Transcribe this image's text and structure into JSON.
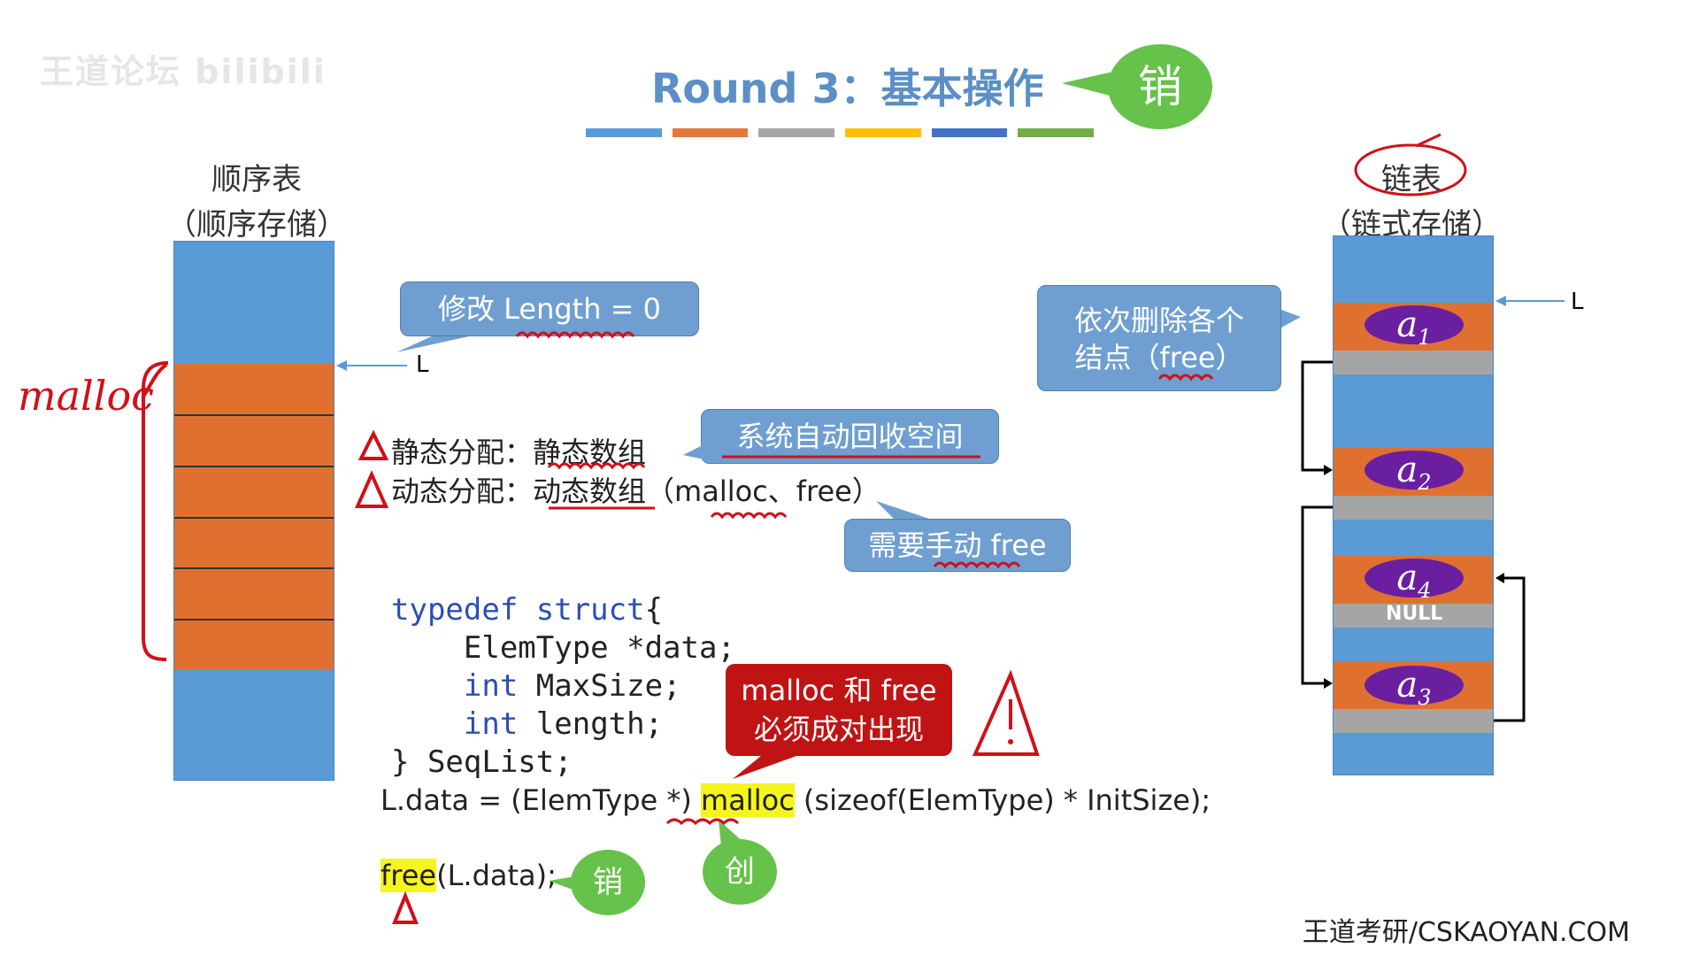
{
  "header": {
    "title": "Round 3：基本操作",
    "badge": "销",
    "strip_colors": [
      "#5b9bd5",
      "#e07a3c",
      "#a5a5a5",
      "#ffc000",
      "#4472c4",
      "#70ad47"
    ]
  },
  "logo": {
    "text": "王道论坛  bilibili"
  },
  "seq_list": {
    "title_line1": "顺序表",
    "title_line2": "（顺序存储）",
    "pointer": "L",
    "annotation": "malloc"
  },
  "linked_list": {
    "title_line1": "链表",
    "title_line2": "（链式存储）",
    "pointer": "L",
    "nodes": [
      {
        "letter": "a",
        "sub": "1"
      },
      {
        "letter": "a",
        "sub": "2"
      },
      {
        "letter": "a",
        "sub": "4"
      },
      {
        "letter": "a",
        "sub": "3"
      }
    ],
    "null_label": "NULL"
  },
  "callouts": {
    "length": "修改 Length = 0",
    "delete_nodes_line1": "依次删除各个",
    "delete_nodes_line2": "结点（free）",
    "auto_reclaim": "系统自动回收空间",
    "manual_free": "需要手动 free",
    "pair_line1": "malloc 和 free",
    "pair_line2": "必须成对出现"
  },
  "alloc": {
    "static_label": "静态分配：",
    "static_value": "静态数组",
    "dynamic_label": "动态分配：",
    "dynamic_value": "动态数组",
    "dynamic_extra": "（malloc、free）"
  },
  "code": {
    "line1_kw": "typedef struct",
    "line1_rest": "{",
    "line2": "    ElemType *data;",
    "line3_kw": "int",
    "line3_rest": " MaxSize;",
    "line4_kw": "int",
    "line4_rest": " length;",
    "line5": "} SeqList;"
  },
  "statements": {
    "malloc_prefix": "L.data = (ElemType *) ",
    "malloc_fn": "malloc",
    "malloc_suffix": " (sizeof(ElemType) * InitSize);",
    "free_fn": "free",
    "free_suffix": "(L.data);",
    "badge_destroy": "销",
    "badge_create": "创"
  },
  "footer": {
    "watermark": "王道考研/CSKAOYAN.COM"
  }
}
